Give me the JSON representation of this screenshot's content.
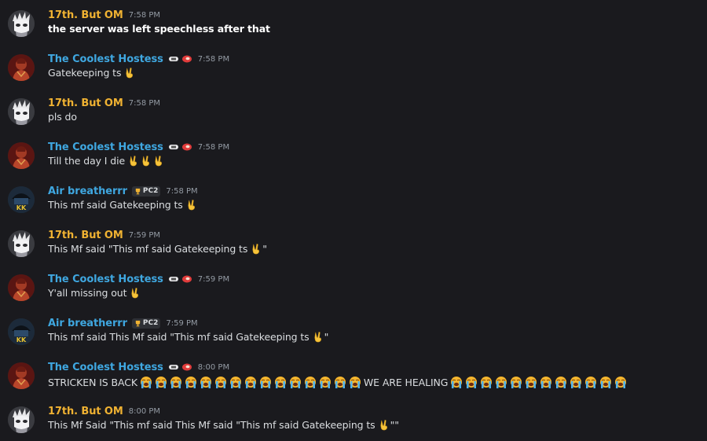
{
  "colors": {
    "om_name": "#f0b232",
    "hostess_name": "#3fa7e0",
    "air_name": "#3fa7e0",
    "timestamp": "#949ba4",
    "text": "#dbdee1",
    "background": "#1a1a1e"
  },
  "messages": [
    {
      "author": "17th. But OM",
      "time": "7:58 PM",
      "text": "the server was left speechless after that"
    },
    {
      "author": "The Coolest Hostess",
      "time": "7:58 PM",
      "text": "Gatekeeping ts"
    },
    {
      "author": "17th. But OM",
      "time": "7:58 PM",
      "text": "pls do"
    },
    {
      "author": "The Coolest Hostess",
      "time": "7:58 PM",
      "text": "Till the day I die"
    },
    {
      "author": "Air breatherrr",
      "tag": "PC2",
      "time": "7:58 PM",
      "text": "This mf said Gatekeeping ts"
    },
    {
      "author": "17th. But OM",
      "time": "7:59 PM",
      "text": "This Mf said \"This mf said Gatekeeping ts",
      "text_end": "\""
    },
    {
      "author": "The Coolest Hostess",
      "time": "7:59 PM",
      "text": "Y'all missing out"
    },
    {
      "author": "Air breatherrr",
      "tag": "PC2",
      "time": "7:59 PM",
      "text": "This mf said This Mf said \"This mf said Gatekeeping ts",
      "text_end": "\""
    },
    {
      "author": "The Coolest Hostess",
      "time": "8:00 PM",
      "text": "STRICKEN IS BACK",
      "text_middle": "WE ARE HEALING"
    },
    {
      "author": "17th. But OM",
      "time": "8:00 PM",
      "text": "This Mf Said \"This mf said This Mf said \"This mf said Gatekeeping ts",
      "text_end": "\"\""
    }
  ],
  "icons": {
    "victory_hand": "victory-hand-emoji",
    "crying_face": "loudly-crying-face-emoji",
    "trophy": "trophy-icon",
    "badge_a": "pill-badge-icon",
    "badge_b": "meat-badge-icon"
  }
}
